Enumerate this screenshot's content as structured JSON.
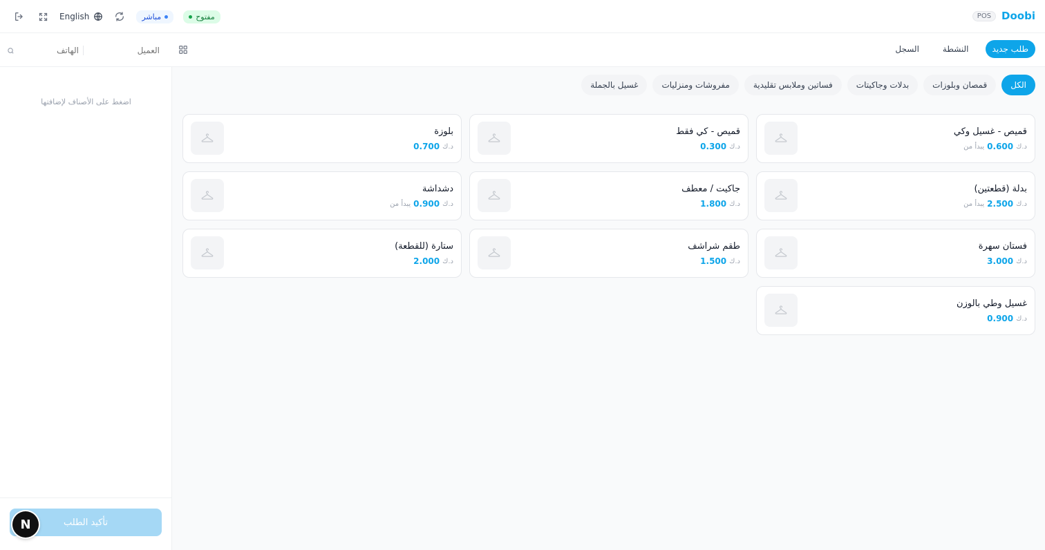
{
  "brand": {
    "name": "Doobi",
    "badge": "POS"
  },
  "topbar": {
    "status_open": "مفتوح",
    "status_live": "مباشر",
    "language": "English",
    "colors": {
      "open": "#15803d",
      "live": "#1d4ed8"
    }
  },
  "nav": {
    "tabs": [
      {
        "label": "طلب جديد",
        "active": true
      },
      {
        "label": "النشطة",
        "active": false
      },
      {
        "label": "السجل",
        "active": false
      }
    ]
  },
  "search": {
    "customer_placeholder": "العميل",
    "phone_placeholder": "الهاتف"
  },
  "cart": {
    "empty_text": "اضغط على الأصناف لإضافتها",
    "confirm_label": "تأكيد الطلب",
    "badge": "N"
  },
  "categories": [
    {
      "label": "الكل",
      "active": true
    },
    {
      "label": "قمصان وبلوزات",
      "active": false
    },
    {
      "label": "بدلات وجاكيتات",
      "active": false
    },
    {
      "label": "فساتين وملابس تقليدية",
      "active": false
    },
    {
      "label": "مفروشات ومنزليات",
      "active": false
    },
    {
      "label": "غسيل بالجملة",
      "active": false
    }
  ],
  "currency_symbol": "د.ك",
  "products": [
    {
      "name": "قميص - غسيل وكي",
      "prefix": "يبدأ من",
      "price": "0.600"
    },
    {
      "name": "قميص - كي فقط",
      "prefix": "",
      "price": "0.300"
    },
    {
      "name": "بلوزة",
      "prefix": "",
      "price": "0.700"
    },
    {
      "name": "بدلة (قطعتين)",
      "prefix": "يبدأ من",
      "price": "2.500"
    },
    {
      "name": "جاكيت / معطف",
      "prefix": "",
      "price": "1.800"
    },
    {
      "name": "دشداشة",
      "prefix": "يبدأ من",
      "price": "0.900"
    },
    {
      "name": "فستان سهرة",
      "prefix": "",
      "price": "3.000"
    },
    {
      "name": "طقم شراشف",
      "prefix": "",
      "price": "1.500"
    },
    {
      "name": "ستارة (للقطعة)",
      "prefix": "",
      "price": "2.000"
    },
    {
      "name": "غسيل وطي بالوزن",
      "prefix": "",
      "price": "0.900"
    }
  ],
  "accent_color": "#0ea5e9"
}
